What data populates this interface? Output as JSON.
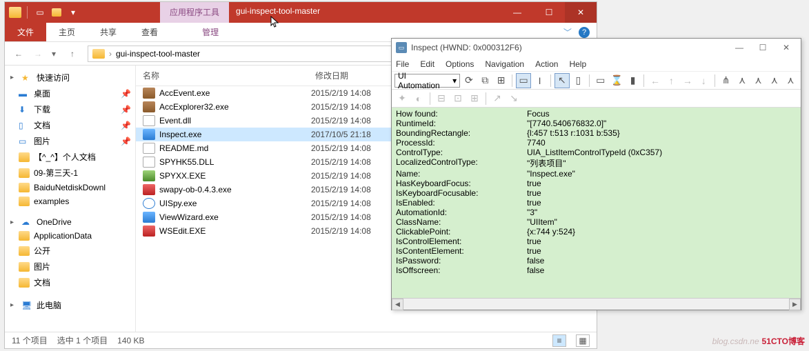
{
  "explorer": {
    "context_tab": "应用程序工具",
    "title": "gui-inspect-tool-master",
    "ribbon": {
      "file": "文件",
      "tabs": [
        "主页",
        "共享",
        "查看"
      ],
      "ctx": "管理"
    },
    "breadcrumb": {
      "folder": "gui-inspect-tool-master"
    },
    "nav": {
      "quick": "快速访问",
      "items1": [
        "桌面",
        "下载",
        "文档",
        "图片",
        "【^_^】个人文档",
        "09-第三天-1",
        "BaiduNetdiskDownl",
        "examples"
      ],
      "onedrive": "OneDrive",
      "items2": [
        "ApplicationData",
        "公开",
        "图片",
        "文档"
      ],
      "thispc": "此电脑"
    },
    "cols": {
      "name": "名称",
      "date": "修改日期"
    },
    "files": [
      {
        "icon": "exe-brown",
        "name": "AccEvent.exe",
        "date": "2015/2/19 14:08"
      },
      {
        "icon": "exe-brown",
        "name": "AccExplorer32.exe",
        "date": "2015/2/19 14:08"
      },
      {
        "icon": "dll-icon",
        "name": "Event.dll",
        "date": "2015/2/19 14:08"
      },
      {
        "icon": "exe-blue",
        "name": "Inspect.exe",
        "date": "2017/10/5 21:18",
        "selected": true
      },
      {
        "icon": "md-icon",
        "name": "README.md",
        "date": "2015/2/19 14:08"
      },
      {
        "icon": "dll-icon",
        "name": "SPYHK55.DLL",
        "date": "2015/2/19 14:08"
      },
      {
        "icon": "exe-green",
        "name": "SPYXX.EXE",
        "date": "2015/2/19 14:08"
      },
      {
        "icon": "exe-red",
        "name": "swapy-ob-0.4.3.exe",
        "date": "2015/2/19 14:08"
      },
      {
        "icon": "exe-eye",
        "name": "UISpy.exe",
        "date": "2015/2/19 14:08"
      },
      {
        "icon": "exe-blue",
        "name": "ViewWizard.exe",
        "date": "2015/2/19 14:08"
      },
      {
        "icon": "exe-red",
        "name": "WSEdit.EXE",
        "date": "2015/2/19 14:08"
      }
    ],
    "status": {
      "count": "11 个项目",
      "sel": "选中 1 个项目",
      "size": "140 KB"
    }
  },
  "inspect": {
    "title": "Inspect  (HWND: 0x000312F6)",
    "menu": [
      "File",
      "Edit",
      "Options",
      "Navigation",
      "Action",
      "Help"
    ],
    "combo": "UI Automation",
    "props": [
      {
        "k": "How found:",
        "v": "Focus"
      },
      {
        "k": "RuntimeId:",
        "v": "\"[7740.540676832.0]\""
      },
      {
        "k": "BoundingRectangle:",
        "v": "{l:457 t:513 r:1031 b:535}"
      },
      {
        "k": "ProcessId:",
        "v": "7740"
      },
      {
        "k": "ControlType:",
        "v": "UIA_ListItemControlTypeId (0xC357)"
      },
      {
        "k": "LocalizedControlType:",
        "v": "\"列表项目\""
      },
      {
        "k": "Name:",
        "v": "\"Inspect.exe\""
      },
      {
        "k": "HasKeyboardFocus:",
        "v": "true"
      },
      {
        "k": "IsKeyboardFocusable:",
        "v": "true"
      },
      {
        "k": "IsEnabled:",
        "v": "true"
      },
      {
        "k": "AutomationId:",
        "v": "\"3\""
      },
      {
        "k": "ClassName:",
        "v": "\"UIItem\""
      },
      {
        "k": "ClickablePoint:",
        "v": "{x:744 y:524}"
      },
      {
        "k": "IsControlElement:",
        "v": "true"
      },
      {
        "k": "IsContentElement:",
        "v": "true"
      },
      {
        "k": "IsPassword:",
        "v": "false"
      },
      {
        "k": "IsOffscreen:",
        "v": "false"
      }
    ]
  },
  "watermark": {
    "text": "blog.csdn.ne",
    "tag": "51CTO博客"
  }
}
